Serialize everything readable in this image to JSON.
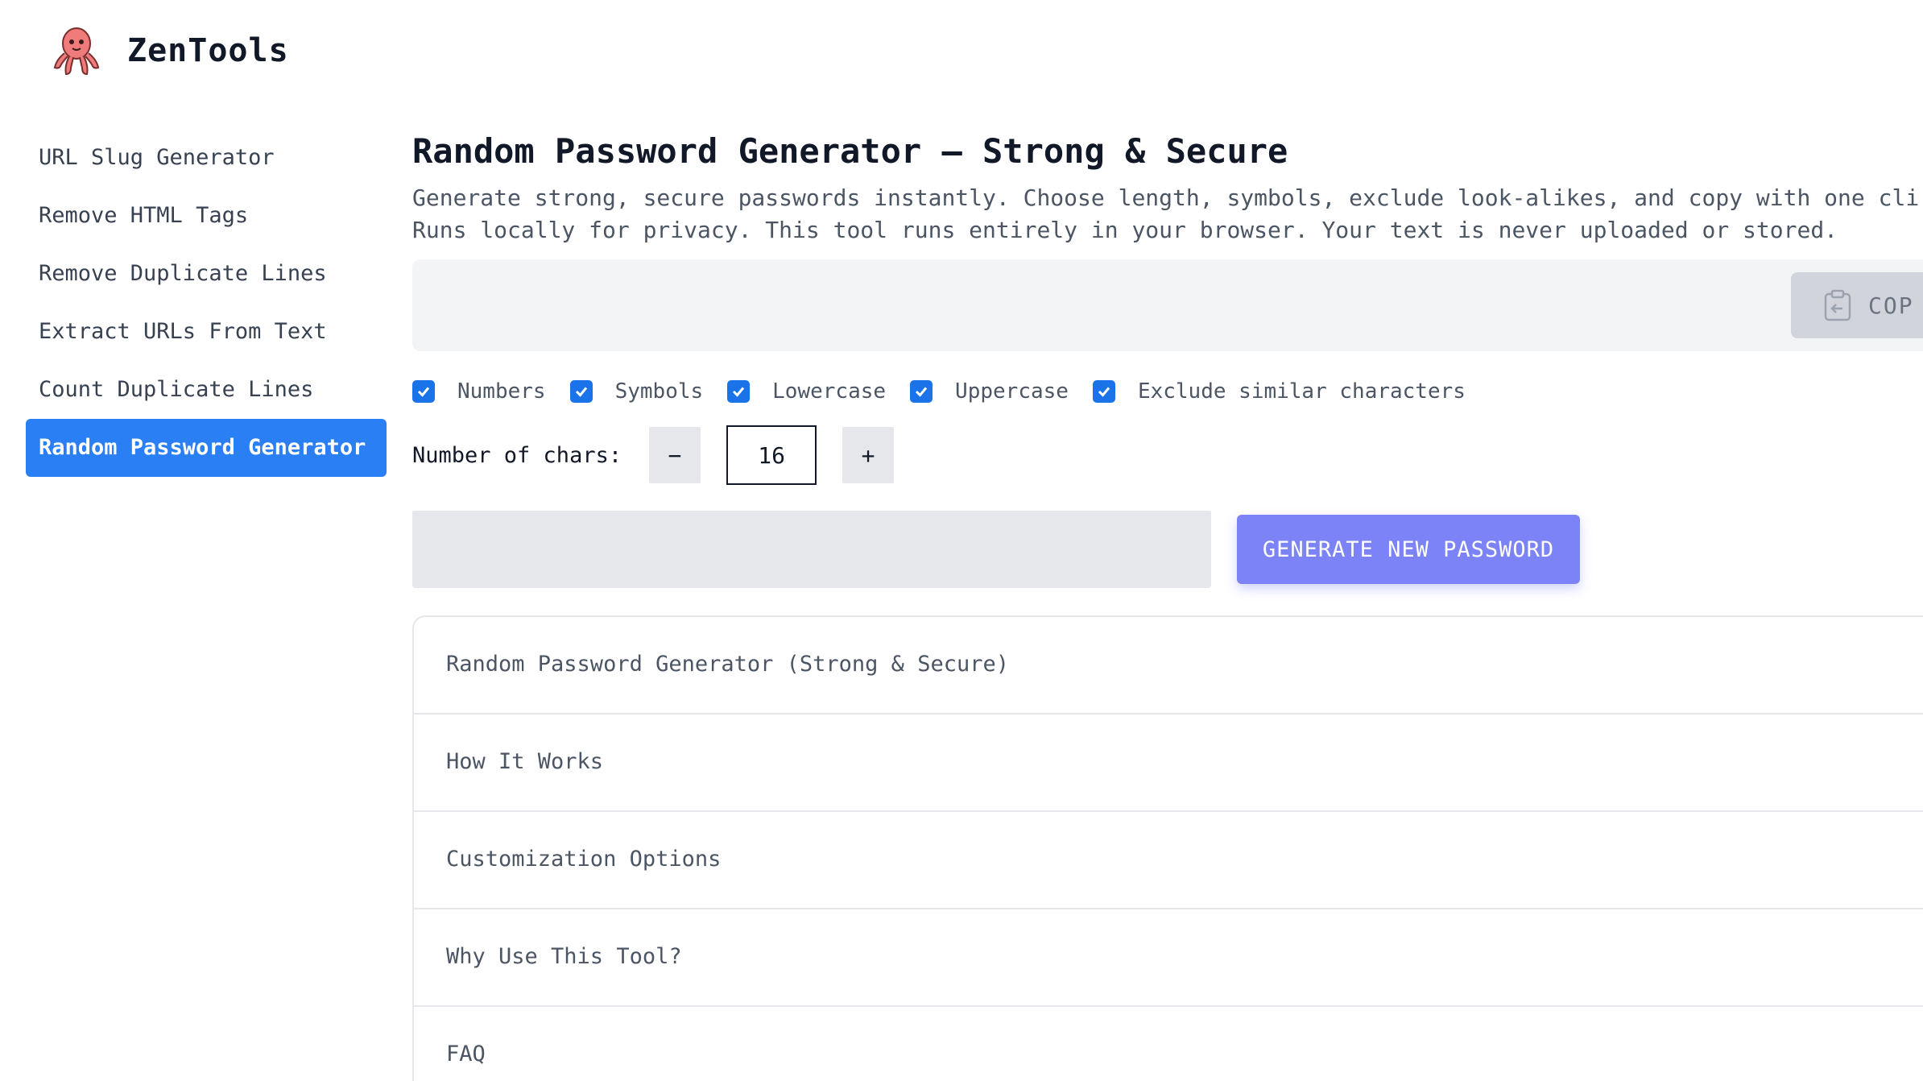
{
  "brand": {
    "name": "ZenTools",
    "logo_icon": "octopus-icon"
  },
  "sidebar": {
    "items": [
      {
        "label": "URL Slug Generator",
        "active": false
      },
      {
        "label": "Remove HTML Tags",
        "active": false
      },
      {
        "label": "Remove Duplicate Lines",
        "active": false
      },
      {
        "label": "Extract URLs From Text",
        "active": false
      },
      {
        "label": "Count Duplicate Lines",
        "active": false
      },
      {
        "label": "Random Password Generator",
        "active": true
      }
    ]
  },
  "main": {
    "title": "Random Password Generator – Strong & Secure",
    "description_line1": "Generate strong, secure passwords instantly. Choose length, symbols, exclude look-alikes, and copy with one cli",
    "description_line2": "Runs locally for privacy. This tool runs entirely in your browser. Your text is never uploaded or stored.",
    "output": {
      "value": "",
      "copy_label": "COP",
      "copy_icon": "clipboard-icon"
    },
    "options": [
      {
        "label": "Numbers",
        "checked": true
      },
      {
        "label": "Symbols",
        "checked": true
      },
      {
        "label": "Lowercase",
        "checked": true
      },
      {
        "label": "Uppercase",
        "checked": true
      },
      {
        "label": "Exclude similar characters",
        "checked": true
      }
    ],
    "length": {
      "label": "Number of chars:",
      "value": "16",
      "decrement_label": "−",
      "increment_label": "+"
    },
    "password_field": {
      "value": ""
    },
    "generate_label": "GENERATE NEW PASSWORD",
    "accordion": [
      {
        "label": "Random Password Generator (Strong & Secure)"
      },
      {
        "label": "How It Works"
      },
      {
        "label": "Customization Options"
      },
      {
        "label": "Why Use This Tool?"
      },
      {
        "label": "FAQ"
      }
    ]
  },
  "colors": {
    "accent": "#2b7ff5",
    "checkbox": "#1a73e8",
    "generate_button": "#7c83f7",
    "logo": "#e86a6a"
  }
}
